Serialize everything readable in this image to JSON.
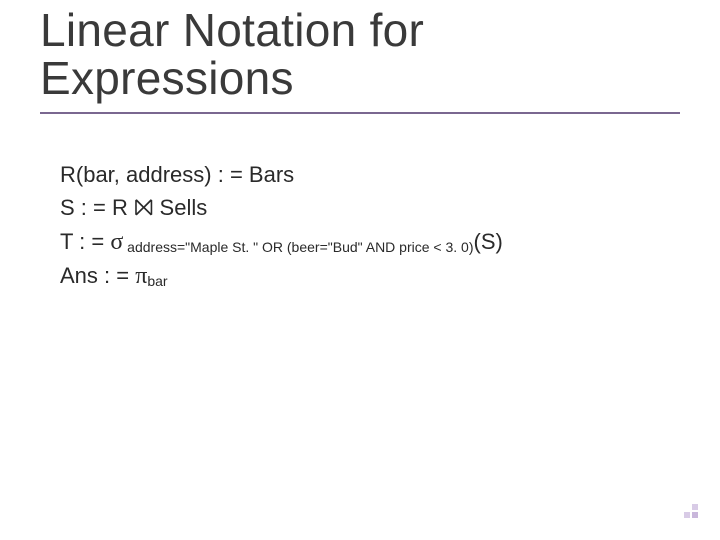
{
  "title": "Linear Notation for Expressions",
  "lines": {
    "l1": {
      "text": "R(bar, address) : = Bars"
    },
    "l2": {
      "pre": "S : = R ",
      "join": "⨝",
      "post": " Sells"
    },
    "l3": {
      "pre": "T : = ",
      "sigma": "σ",
      "cond": " address=\"Maple St. \" OR (beer=\"Bud\" AND price < 3. 0)",
      "post": "(S)"
    },
    "l4": {
      "pre": "Ans : = ",
      "pi": "π",
      "sub": "bar"
    }
  }
}
